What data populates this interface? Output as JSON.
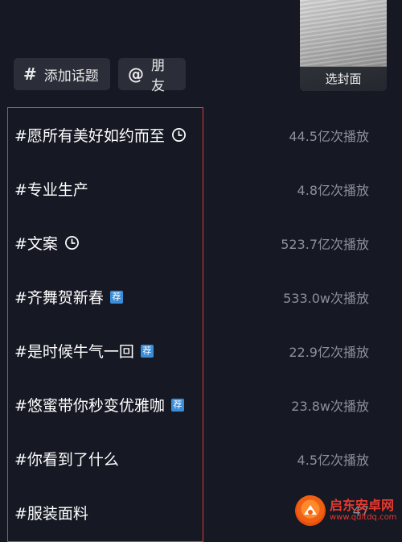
{
  "cover": {
    "label": "选封面"
  },
  "chips": {
    "topic": {
      "symbol": "#",
      "label": "添加话题"
    },
    "friend": {
      "symbol": "@",
      "label": "朋友"
    }
  },
  "topics": [
    {
      "title": "#愿所有美好如约而至",
      "views": "44.5亿次播放",
      "mark": "clock"
    },
    {
      "title": "#专业生产",
      "views": "4.8亿次播放",
      "mark": ""
    },
    {
      "title": "#文案",
      "views": "523.7亿次播放",
      "mark": "clock"
    },
    {
      "title": "#齐舞贺新春",
      "views": "533.0w次播放",
      "mark": "recommend"
    },
    {
      "title": "#是时候牛气一回",
      "views": "22.9亿次播放",
      "mark": "recommend"
    },
    {
      "title": "#悠蜜带你秒变优雅咖",
      "views": "23.8w次播放",
      "mark": "recommend"
    },
    {
      "title": "#你看到了什么",
      "views": "4.5亿次播放",
      "mark": ""
    },
    {
      "title": "#服装面料",
      "views": "47",
      "mark": ""
    }
  ],
  "badge_text": "荐",
  "watermark": {
    "name": "启东安卓网",
    "url": "www.qdltdq.com"
  },
  "colors": {
    "background": "#161823",
    "highlight_border": "#e03a3a",
    "badge": "#3a8dd9",
    "muted_text": "#8d8f99"
  }
}
